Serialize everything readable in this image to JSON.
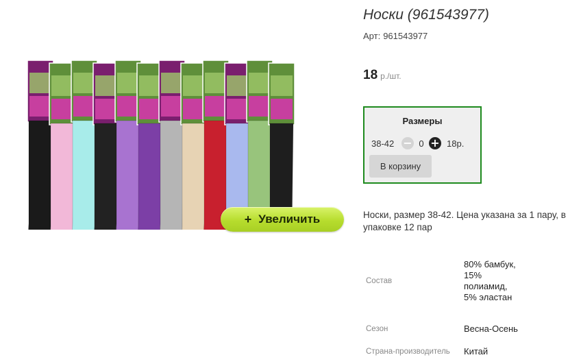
{
  "product": {
    "title": "Носки (961543977)",
    "article_label": "Арт:",
    "article_value": "961543977",
    "price_value": "18",
    "price_unit": "р./шт.",
    "zoom_button_label": "Увеличить",
    "zoom_button_icon": "+"
  },
  "sizes": {
    "heading": "Размеры",
    "rows": [
      {
        "size": "38-42",
        "quantity": "0",
        "price": "18р."
      }
    ],
    "minus_icon": "−",
    "plus_icon": "+",
    "cart_button_label": "В корзину"
  },
  "description": "Носки, размер 38-42. Цена указана за 1 пару, в упаковке 12 пар",
  "properties": [
    {
      "name": "Состав",
      "value": "80% бамбук, 15% полиамид, 5% эластан"
    },
    {
      "name": "Сезон",
      "value": "Весна-Осень"
    },
    {
      "name": "Страна-производитель",
      "value": "Китай"
    }
  ],
  "colors": {
    "sizes_border": "#1d8a1d",
    "zoom_button": "#b7dd2e",
    "sock_colors": [
      "#1a1a1a",
      "#f2b8d8",
      "#a8ecea",
      "#222222",
      "#a873d0",
      "#7c3fa6",
      "#b5b5b5",
      "#e7d3b4",
      "#c8202e",
      "#a9b9ee",
      "#98c47c",
      "#1e1e1e"
    ]
  }
}
